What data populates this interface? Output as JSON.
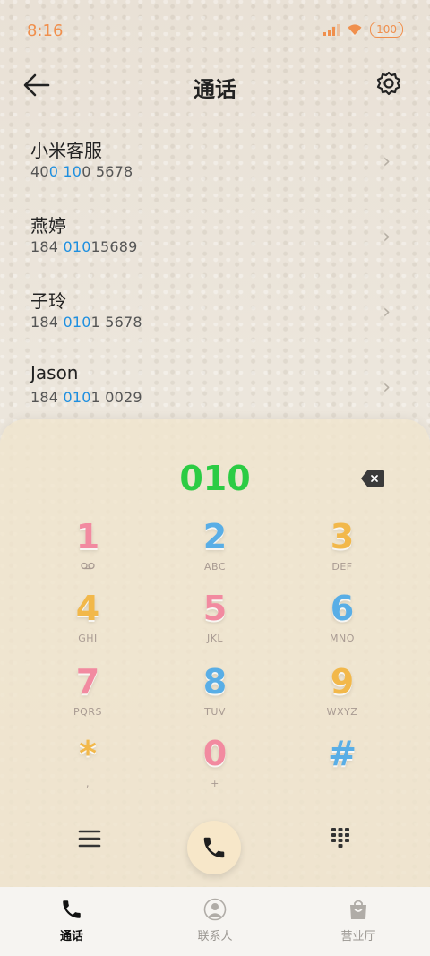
{
  "status_bar": {
    "time": "8:16",
    "battery": "100"
  },
  "header": {
    "title": "通话"
  },
  "results": [
    {
      "name": "小米客服",
      "num_pre": "40",
      "num_hl": "0 10",
      "num_post": "0 5678"
    },
    {
      "name": "燕婷",
      "num_pre": "184 ",
      "num_hl": "010",
      "num_post": "15689"
    },
    {
      "name": "子玲",
      "num_pre": "184 ",
      "num_hl": "010",
      "num_post": "1 5678"
    },
    {
      "name": "Jason",
      "num_pre": "184 ",
      "num_hl": "010",
      "num_post": "1 0029"
    }
  ],
  "dialer": {
    "typed": "010",
    "keys": [
      {
        "digit": "1",
        "letters": "",
        "color": "#f28aa0"
      },
      {
        "digit": "2",
        "letters": "ABC",
        "color": "#59aee6"
      },
      {
        "digit": "3",
        "letters": "DEF",
        "color": "#f2b84a"
      },
      {
        "digit": "4",
        "letters": "GHI",
        "color": "#f2b84a"
      },
      {
        "digit": "5",
        "letters": "JKL",
        "color": "#f28aa0"
      },
      {
        "digit": "6",
        "letters": "MNO",
        "color": "#59aee6"
      },
      {
        "digit": "7",
        "letters": "PQRS",
        "color": "#f28aa0"
      },
      {
        "digit": "8",
        "letters": "TUV",
        "color": "#59aee6"
      },
      {
        "digit": "9",
        "letters": "WXYZ",
        "color": "#f2b84a"
      },
      {
        "digit": "*",
        "letters": ",",
        "color": "#f2b84a"
      },
      {
        "digit": "0",
        "letters": "+",
        "color": "#f28aa0"
      },
      {
        "digit": "#",
        "letters": "",
        "color": "#59aee6"
      }
    ]
  },
  "nav": [
    {
      "label": "通话",
      "active": true
    },
    {
      "label": "联系人",
      "active": false
    },
    {
      "label": "营业厅",
      "active": false
    }
  ],
  "colors": {
    "accent_orange": "#f08f4c",
    "highlight_blue": "#1e8fe0",
    "typed_green": "#2ccc44"
  }
}
